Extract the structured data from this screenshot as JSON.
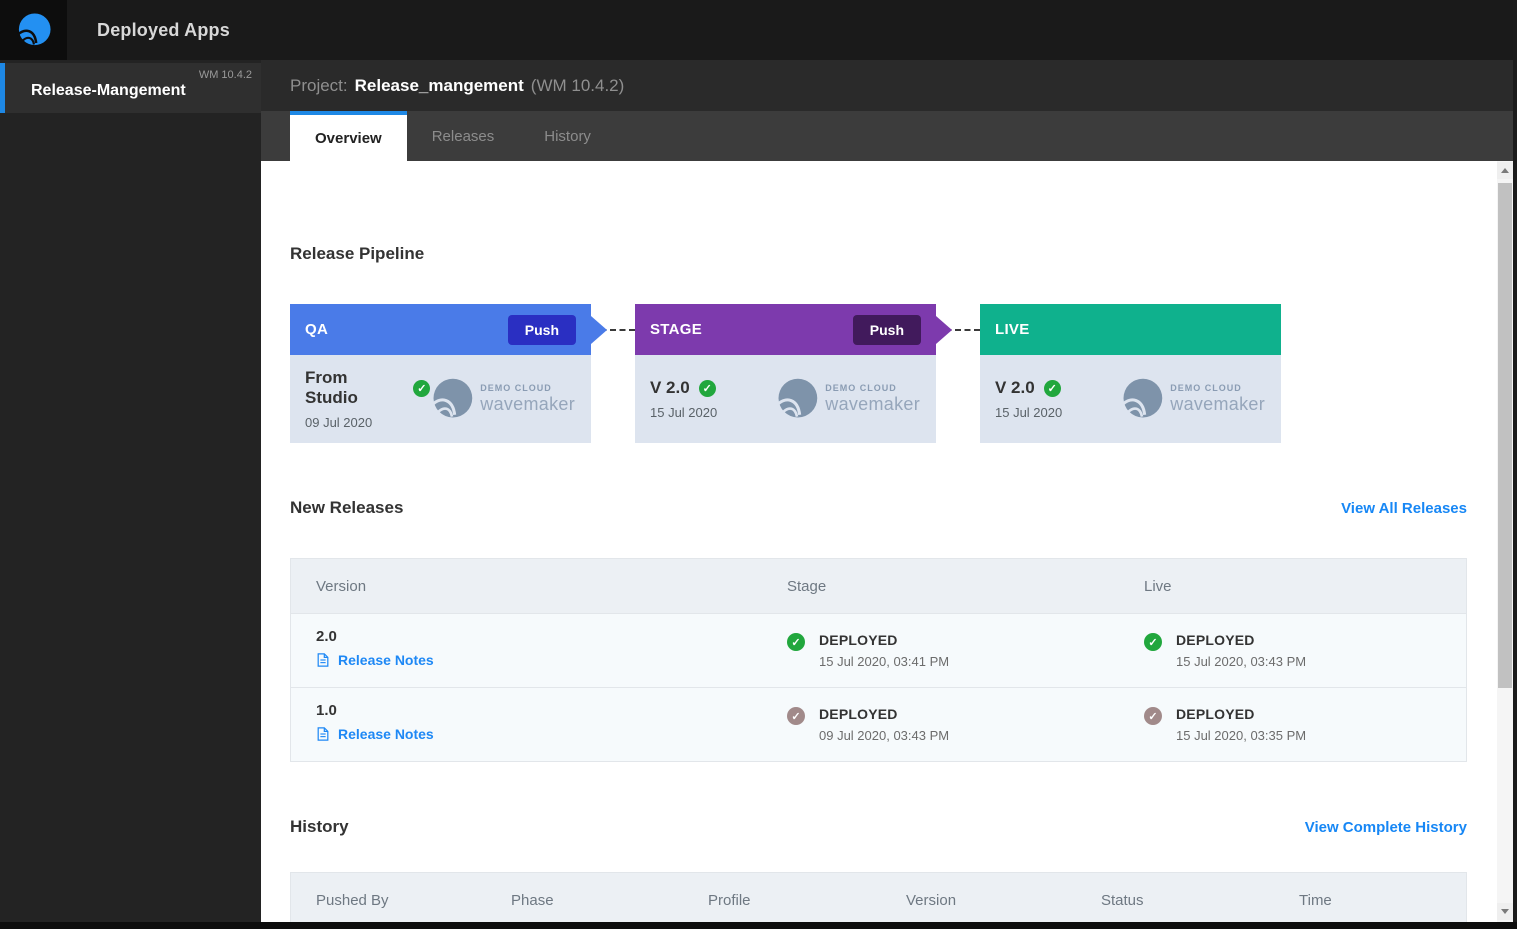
{
  "topbar": {
    "title": "Deployed Apps"
  },
  "sidebar": {
    "item": {
      "label": "Release-Mangement",
      "version": "WM 10.4.2"
    }
  },
  "project_header": {
    "prefix": "Project:",
    "name": "Release_mangement",
    "version": "(WM 10.4.2)"
  },
  "tabs": {
    "overview": "Overview",
    "releases": "Releases",
    "history": "History"
  },
  "pipeline": {
    "heading": "Release Pipeline",
    "stages": [
      {
        "name": "QA",
        "header_color": "#4a7be8",
        "push_label": "Push",
        "push_color": "#2a2fc2",
        "version": "From Studio",
        "date": "09 Jul 2020",
        "check_color": "#21a73d"
      },
      {
        "name": "STAGE",
        "header_color": "#7d3aad",
        "push_label": "Push",
        "push_color": "#411a5c",
        "version": "V 2.0",
        "date": "15 Jul 2020",
        "check_color": "#21a73d"
      },
      {
        "name": "LIVE",
        "header_color": "#0fb18d",
        "version": "V 2.0",
        "date": "15 Jul 2020",
        "check_color": "#21a73d"
      }
    ],
    "logo_text_top": "DEMO CLOUD",
    "logo_text_bottom": "wavemaker"
  },
  "new_releases": {
    "heading": "New Releases",
    "view_all_label": "View All Releases",
    "columns": {
      "version": "Version",
      "stage": "Stage",
      "live": "Live"
    },
    "rows": [
      {
        "version": "2.0",
        "notes_label": "Release Notes",
        "stage_status": "DEPLOYED",
        "stage_time": "15 Jul 2020, 03:41 PM",
        "stage_icon_color": "#21a73d",
        "live_status": "DEPLOYED",
        "live_time": "15 Jul 2020, 03:43 PM",
        "live_icon_color": "#21a73d"
      },
      {
        "version": "1.0",
        "notes_label": "Release Notes",
        "stage_status": "DEPLOYED",
        "stage_time": "09 Jul 2020, 03:43 PM",
        "stage_icon_color": "#a18a8a",
        "live_status": "DEPLOYED",
        "live_time": "15 Jul 2020, 03:35 PM",
        "live_icon_color": "#a18a8a"
      }
    ]
  },
  "history": {
    "heading": "History",
    "view_all_label": "View Complete History",
    "columns": [
      "Pushed By",
      "Phase",
      "Profile",
      "Version",
      "Status",
      "Time"
    ]
  },
  "colors": {
    "accent_blue": "#1e88e5",
    "link_blue": "#1787f5",
    "check_green": "#21a73d",
    "check_muted": "#a18a8a"
  }
}
